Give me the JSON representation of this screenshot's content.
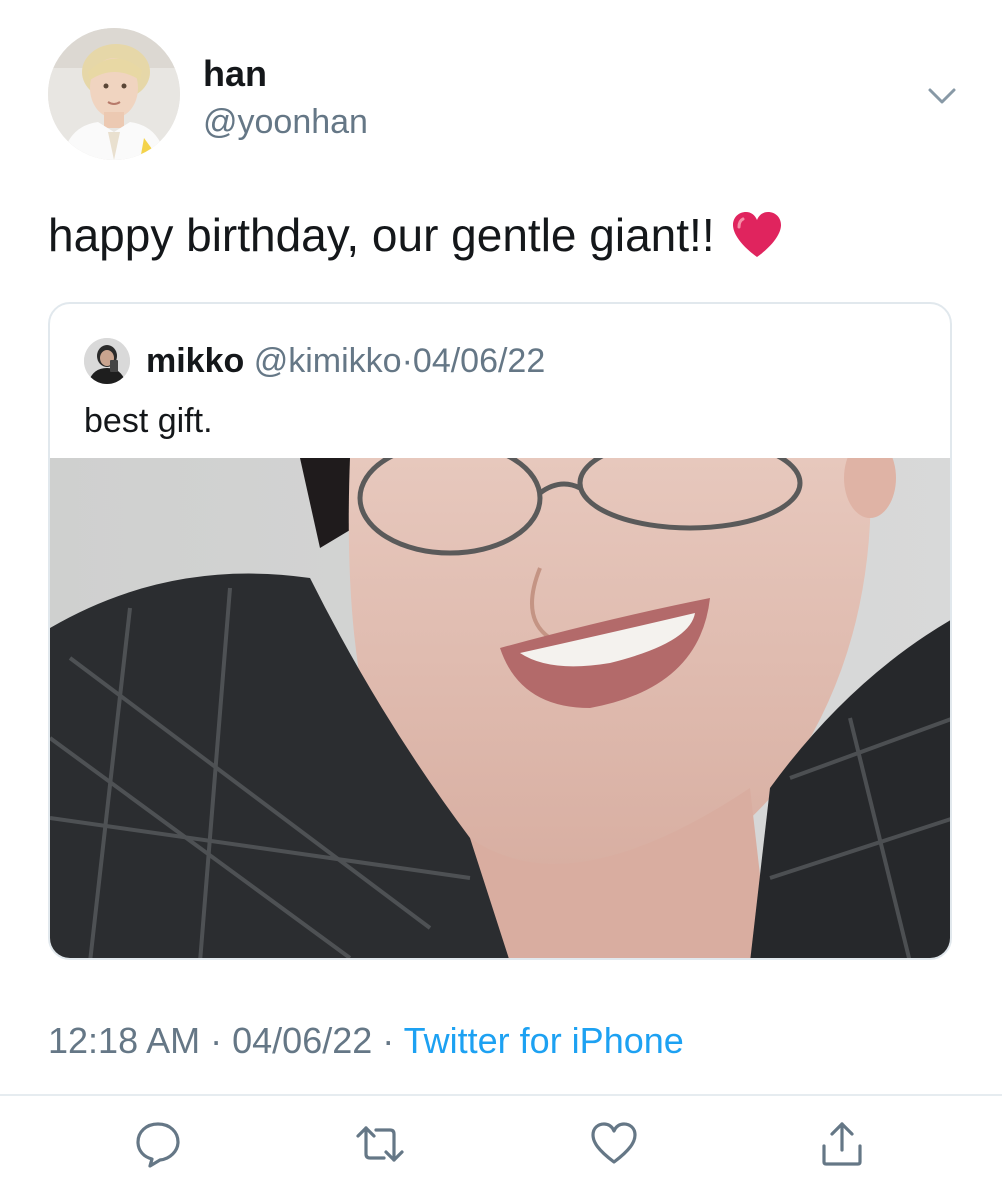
{
  "tweet": {
    "author_name": "han",
    "author_handle": "@yoonhan",
    "text": "happy birthday, our gentle giant!!",
    "emoji": "heart-emoji"
  },
  "quote": {
    "author_name": "mikko",
    "author_handle": "@kimikko",
    "separator": "·",
    "date": "04/06/22",
    "text": "best gift."
  },
  "meta": {
    "time": "12:18 AM",
    "separator1": "·",
    "date": "04/06/22",
    "separator2": "·",
    "source": "Twitter for iPhone"
  },
  "actions": [
    "reply-icon",
    "retweet-icon",
    "like-icon",
    "share-icon"
  ],
  "colors": {
    "primary_text": "#14171a",
    "secondary_text": "#657786",
    "link": "#1da1f2",
    "border": "#e1e8ed",
    "heart": "#e0245e"
  }
}
